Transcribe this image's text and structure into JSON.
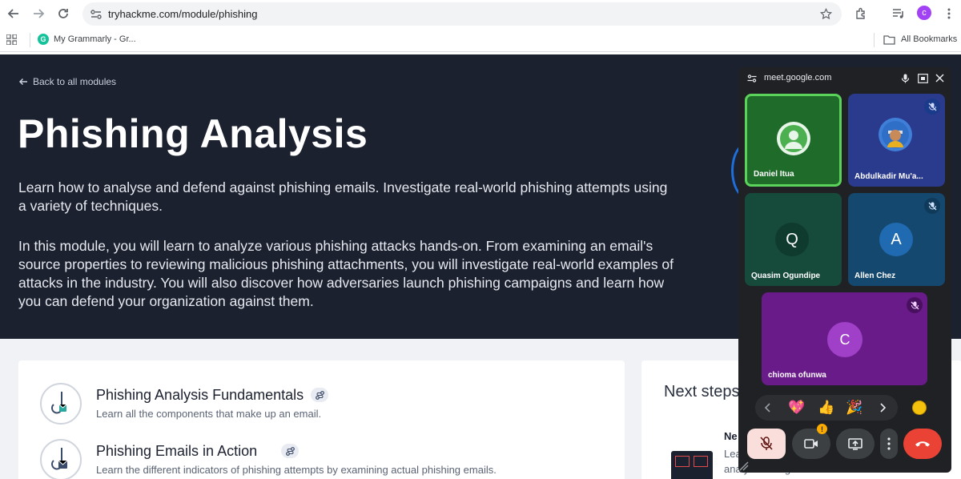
{
  "browser": {
    "url": "tryhackme.com/module/phishing",
    "bookmark_grammarly": "My Grammarly - Gr...",
    "all_bookmarks": "All Bookmarks",
    "profile_initial": "c"
  },
  "hero": {
    "back_link": "Back to all modules",
    "title": "Phishing Analysis",
    "intro": "Learn how to analyse and defend against phishing emails. Investigate real-world phishing attempts using a variety of techniques.",
    "description": "In this module, you will learn to analyze various phishing attacks hands-on. From examining an email's source properties to reviewing malicious phishing attachments, you will investigate real-world examples of attacks in the industry. You will also discover how adversaries launch phishing campaigns and learn how you can defend your organization against them."
  },
  "rooms": [
    {
      "title": "Phishing Analysis Fundamentals",
      "subtitle": "Learn all the components that make up an email."
    },
    {
      "title": "Phishing Emails in Action",
      "subtitle": "Learn the different indicators of phishing attempts by examining actual phishing emails."
    }
  ],
  "side": {
    "next_steps": "Next steps",
    "item_title": "Ne",
    "item_text_1": "Lea",
    "item_text_2": "analysis and get hands-on with"
  },
  "meet": {
    "url": "meet.google.com",
    "participants": [
      {
        "name": "Daniel Itua",
        "initial": "",
        "muted": false,
        "active": true
      },
      {
        "name": "Abdulkadir Mu'a...",
        "initial": "",
        "muted": true,
        "active": false
      },
      {
        "name": "Quasim Ogundipe",
        "initial": "Q",
        "muted": false,
        "active": false
      },
      {
        "name": "Allen Chez",
        "initial": "A",
        "muted": true,
        "active": false
      },
      {
        "name": "chioma ofunwa",
        "initial": "C",
        "muted": true,
        "active": false
      }
    ],
    "emojis": [
      "💖",
      "👍",
      "🎉"
    ],
    "colors": {
      "active_border": "#5bd35b",
      "end_call": "#ea4335",
      "mic_off_bg": "#f9dedc"
    }
  }
}
